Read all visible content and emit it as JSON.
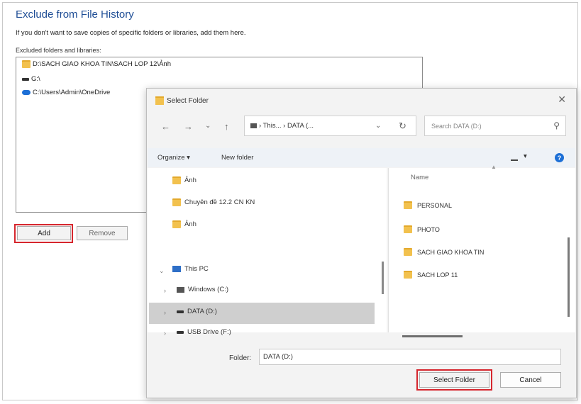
{
  "main": {
    "title": "Exclude from File History",
    "description": "If you don't want to save copies of specific folders or libraries, add them here.",
    "list_label": "Excluded folders and libraries:",
    "excluded_items": [
      "D:\\SACH GIAO KHOA TIN\\SACH LOP 12\\Ảnh",
      "G:\\",
      "C:\\Users\\Admin\\OneDrive"
    ],
    "add_label": "Add",
    "remove_label": "Remove"
  },
  "dialog": {
    "title": "Select Folder",
    "address": "› This... › DATA (...",
    "search_placeholder": "Search DATA (D:)",
    "organize_label": "Organize ▾",
    "new_folder_label": "New folder",
    "nav_items": [
      {
        "label": "Ảnh",
        "icon": "folder-icon"
      },
      {
        "label": "Chuyên đề 12.2 CN KN",
        "icon": "folder-icon"
      },
      {
        "label": "Ảnh",
        "icon": "folder-icon"
      },
      {
        "label": "This PC",
        "icon": "pc-icon"
      },
      {
        "label": "Windows (C:)",
        "icon": "drive-icon"
      },
      {
        "label": "DATA (D:)",
        "icon": "drive-icon"
      },
      {
        "label": "USB Drive (F:)",
        "icon": "drive-icon"
      }
    ],
    "column_header": "Name",
    "files": [
      "PERSONAL",
      "PHOTO",
      "SACH GIAO KHOA TIN",
      "SACH LOP 11"
    ],
    "folder_label": "Folder:",
    "folder_value": "DATA (D:)",
    "select_label": "Select Folder",
    "cancel_label": "Cancel"
  },
  "colors": {
    "title_blue": "#1f4e96",
    "highlight_red": "#d6262d",
    "folder_yellow": "#f2c14e",
    "accent_blue": "#1d6fd6"
  }
}
